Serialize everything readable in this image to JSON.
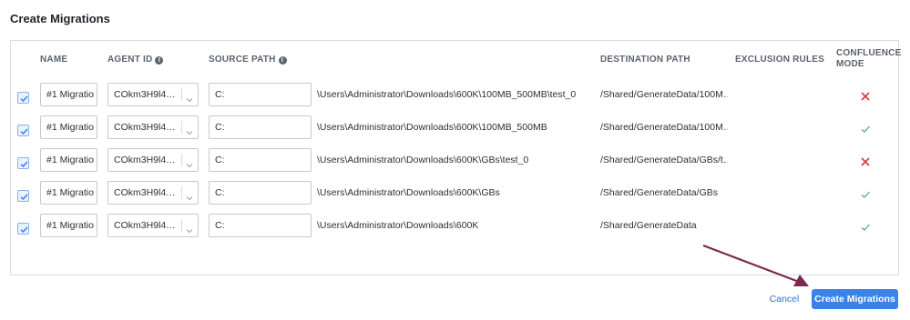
{
  "title": "Create Migrations",
  "columns": {
    "name": "NAME",
    "agent_id": "AGENT ID",
    "source_path": "SOURCE PATH",
    "destination_path": "DESTINATION PATH",
    "exclusion_rules": "EXCLUSION RULES",
    "confluence_mode_line1": "CONFLUENCE",
    "confluence_mode_line2": "MODE"
  },
  "info_icon_glyph": "i",
  "rows": [
    {
      "checked": true,
      "name": "#1 Migratio",
      "agent_id": "COkm3H9l4…",
      "source_drive": "C:",
      "source_path": "\\Users\\Administrator\\Downloads\\600K\\100MB_500MB\\test_0",
      "destination_path": "/Shared/GenerateData/100M…",
      "confluence_mode": "cross-icon"
    },
    {
      "checked": true,
      "name": "#1 Migratio",
      "agent_id": "COkm3H9l4…",
      "source_drive": "C:",
      "source_path": "\\Users\\Administrator\\Downloads\\600K\\100MB_500MB",
      "destination_path": "/Shared/GenerateData/100M…",
      "confluence_mode": "check-icon"
    },
    {
      "checked": true,
      "name": "#1 Migratio",
      "agent_id": "COkm3H9l4…",
      "source_drive": "C:",
      "source_path": "\\Users\\Administrator\\Downloads\\600K\\GBs\\test_0",
      "destination_path": "/Shared/GenerateData/GBs/t…",
      "confluence_mode": "cross-icon"
    },
    {
      "checked": true,
      "name": "#1 Migratio",
      "agent_id": "COkm3H9l4…",
      "source_drive": "C:",
      "source_path": "\\Users\\Administrator\\Downloads\\600K\\GBs",
      "destination_path": "/Shared/GenerateData/GBs",
      "confluence_mode": "check-icon"
    },
    {
      "checked": true,
      "name": "#1 Migratio",
      "agent_id": "COkm3H9l4…",
      "source_drive": "C:",
      "source_path": "\\Users\\Administrator\\Downloads\\600K",
      "destination_path": "/Shared/GenerateData",
      "confluence_mode": "check-icon"
    }
  ],
  "buttons": {
    "cancel": "Cancel",
    "create": "Create Migrations"
  },
  "colors": {
    "accent": "#3b82e6",
    "cross": "#d93a3a",
    "check": "#4caf7a",
    "annotation_arrow": "#7a2a4e"
  }
}
